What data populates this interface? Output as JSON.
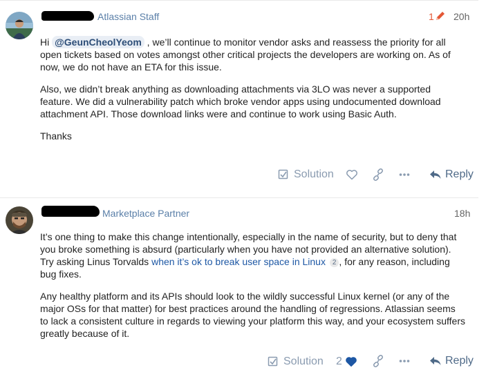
{
  "posts": [
    {
      "author_role": "Atlassian Staff",
      "edit_count": "1",
      "time": "20h",
      "mention": "@GeunCheolYeom",
      "p1_before": "Hi ",
      "p1_after": " , we’ll continue to monitor vendor asks and reassess the priority for all open tickets based on votes amongst other critical projects the developers are working on. As of now, we do not have an ETA for this issue.",
      "p2": "Also, we didn’t break anything as downloading attachments via 3LO was never a supported feature. We did a vulnerability patch which broke vendor apps using undocumented download attachment API. Those download links were and continue to work using Basic Auth.",
      "p3": "Thanks",
      "actions": {
        "solution": "Solution",
        "like_count": "",
        "reply": "Reply"
      }
    },
    {
      "author_role": "Marketplace Partner",
      "time": "18h",
      "p1_before": "It’s one thing to make this change intentionally, especially in the name of security, but to deny that you broke something is absurd (particularly when you have not provided an alternative solution). Try asking Linus Torvalds ",
      "link_text": "when it’s ok to break user space in Linux",
      "link_clicks": "2",
      "p1_after": ", for any reason, including bug fixes.",
      "p2": "Any healthy platform and its APIs should look to the wildly successful Linux kernel (or any of the major OSs for that matter) for best practices around the handling of regressions. Atlassian seems to lack a consistent culture in regards to viewing your platform this way, and your ecosystem suffers greatly because of it.",
      "actions": {
        "solution": "Solution",
        "like_count": "2",
        "reply": "Reply"
      }
    }
  ],
  "colors": {
    "role_link": "#5a7fa8",
    "edit_accent": "#e45735",
    "action_icon": "#8a9bb0",
    "like_active": "#1d57a4",
    "divider": "#e9e9e9"
  },
  "icons": [
    "pencil-icon",
    "checkbox-icon",
    "heart-icon",
    "link-icon",
    "more-icon",
    "reply-arrow-icon"
  ]
}
